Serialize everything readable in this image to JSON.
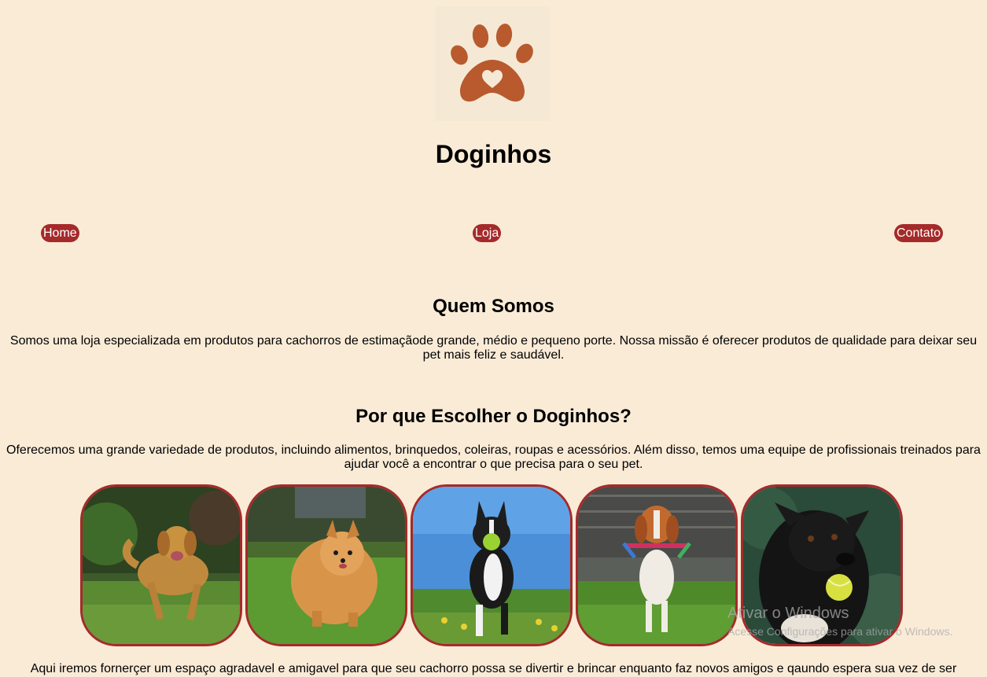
{
  "site": {
    "title": "Doginhos",
    "logo_icon": "paw-heart-icon",
    "logo_color": "#b85a2d",
    "accent_color": "#a52a2a",
    "background_color": "#faebd7"
  },
  "nav": {
    "items": [
      {
        "label": "Home"
      },
      {
        "label": "Loja"
      },
      {
        "label": "Contato"
      }
    ]
  },
  "about": {
    "title": "Quem Somos",
    "text": "Somos uma loja especializada em produtos para cachorros de estimaçãode grande, médio e pequeno porte. Nossa missão é oferecer produtos de qualidade para deixar seu pet mais feliz e saudável."
  },
  "why": {
    "title": "Por que Escolher o Doginhos?",
    "text": "Oferecemos uma grande variedade de produtos, incluindo alimentos, brinquedos, coleiras, roupas e acessórios. Além disso, temos uma equipe de profissionais treinados para ajudar você a encontrar o que precisa para o seu pet."
  },
  "gallery": {
    "images": [
      {
        "name": "golden-retriever-photo"
      },
      {
        "name": "pomeranian-photo"
      },
      {
        "name": "boston-terrier-photo"
      },
      {
        "name": "beagle-photo"
      },
      {
        "name": "border-collie-photo"
      }
    ]
  },
  "footer_text": "Aqui iremos fornerçer um espaço agradavel e amigavel para que seu cachorro possa se divertir e brincar enquanto faz novos amigos e qaundo espera sua vez de ser",
  "windows_watermark": {
    "line1": "Ativar o Windows",
    "line2": "Acesse Configurações para ativar o Windows."
  }
}
